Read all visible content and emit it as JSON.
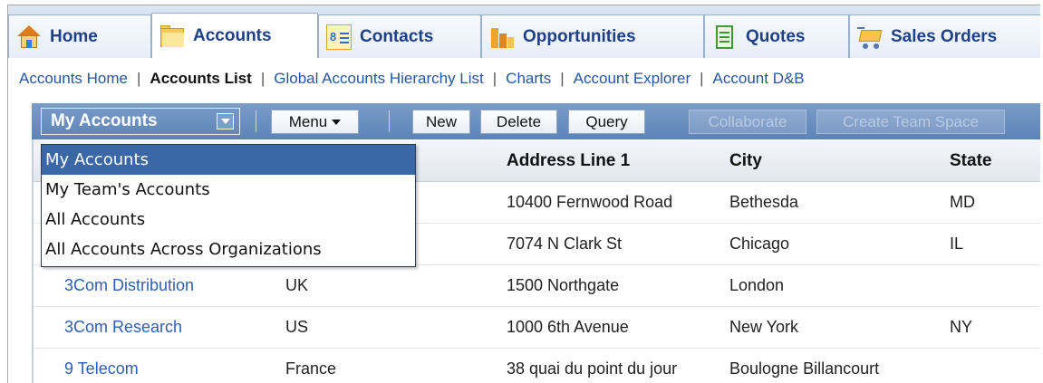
{
  "tabs": [
    {
      "label": "Home",
      "icon": "home-icon"
    },
    {
      "label": "Accounts",
      "icon": "folder-icon",
      "active": true
    },
    {
      "label": "Contacts",
      "icon": "contact-card-icon"
    },
    {
      "label": "Opportunities",
      "icon": "bar-chart-icon"
    },
    {
      "label": "Quotes",
      "icon": "document-icon"
    },
    {
      "label": "Sales Orders",
      "icon": "shopping-cart-icon"
    }
  ],
  "subnav": {
    "items": [
      "Accounts Home",
      "Accounts List",
      "Global Accounts Hierarchy List",
      "Charts",
      "Account Explorer",
      "Account D&B"
    ],
    "current": "Accounts List",
    "separator": "|"
  },
  "toolbar": {
    "view_label": "My Accounts",
    "menu_label": "Menu",
    "new_label": "New",
    "delete_label": "Delete",
    "query_label": "Query",
    "collaborate_label": "Collaborate",
    "team_space_label": "Create Team Space"
  },
  "view_options": [
    "My Accounts",
    "My Team's Accounts",
    "All Accounts",
    "All Accounts Across Organizations"
  ],
  "table": {
    "columns": [
      "Address Line 1",
      "City",
      "State"
    ],
    "rows": [
      {
        "name": "",
        "site": "",
        "address": "10400 Fernwood Road",
        "city": "Bethesda",
        "state": "MD"
      },
      {
        "name": "",
        "site": "",
        "address": "7074 N Clark St",
        "city": "Chicago",
        "state": "IL"
      },
      {
        "name": "3Com Distribution",
        "site": "UK",
        "address": "1500 Northgate",
        "city": "London",
        "state": ""
      },
      {
        "name": "3Com Research",
        "site": "US",
        "address": "1000 6th Avenue",
        "city": "New York",
        "state": "NY"
      },
      {
        "name": "9 Telecom",
        "site": "France",
        "address": "38 quai du point du jour",
        "city": "Boulogne Billancourt",
        "state": ""
      }
    ]
  },
  "colors": {
    "toolbar": "#6a8fc0",
    "selected": "#3a67a6",
    "link": "#2f5fb5",
    "tab_text": "#1f3f87"
  }
}
